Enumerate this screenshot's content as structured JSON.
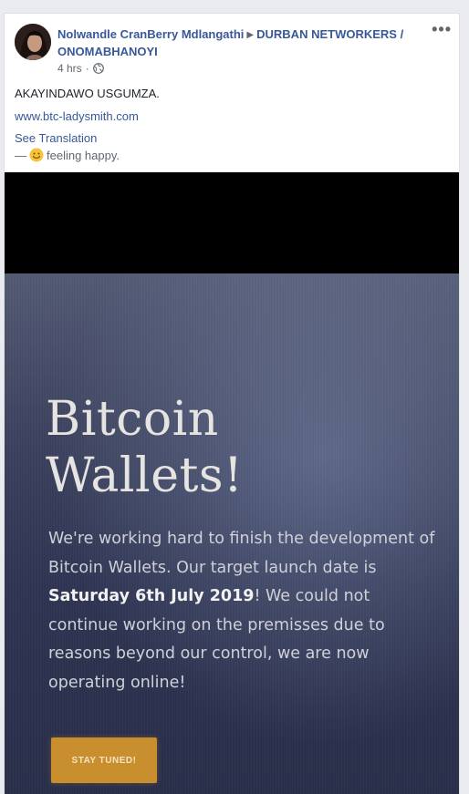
{
  "post": {
    "author": "Nolwandle CranBerry Mdlangathi",
    "group": "DURBAN NETWORKERS / ONOMABHANOYI",
    "time": "4 hrs",
    "message": "AKAYINDAWO USGUMZA.",
    "link": "www.btc-ladysmith.com",
    "see_translation": "See Translation",
    "feeling_prefix": "—",
    "feeling": "feeling happy."
  },
  "photo": {
    "headline_line1": "Bitcoin",
    "headline_line2": "Wallets!",
    "body_part1": "We're working hard to finish the development of Bitcoin Wallets. Our target launch date is ",
    "body_bold": "Saturday 6th July 2019",
    "body_part2": "! We could not continue working on the premisses due to reasons beyond our control, we are now operating online!",
    "cta": "STAY TUNED!"
  },
  "icons": {
    "more": "more-options-icon",
    "globe": "globe-icon",
    "smiley": "smiley-icon"
  },
  "colors": {
    "link": "#385898",
    "meta": "#606770",
    "cta": "#c98f2f"
  }
}
